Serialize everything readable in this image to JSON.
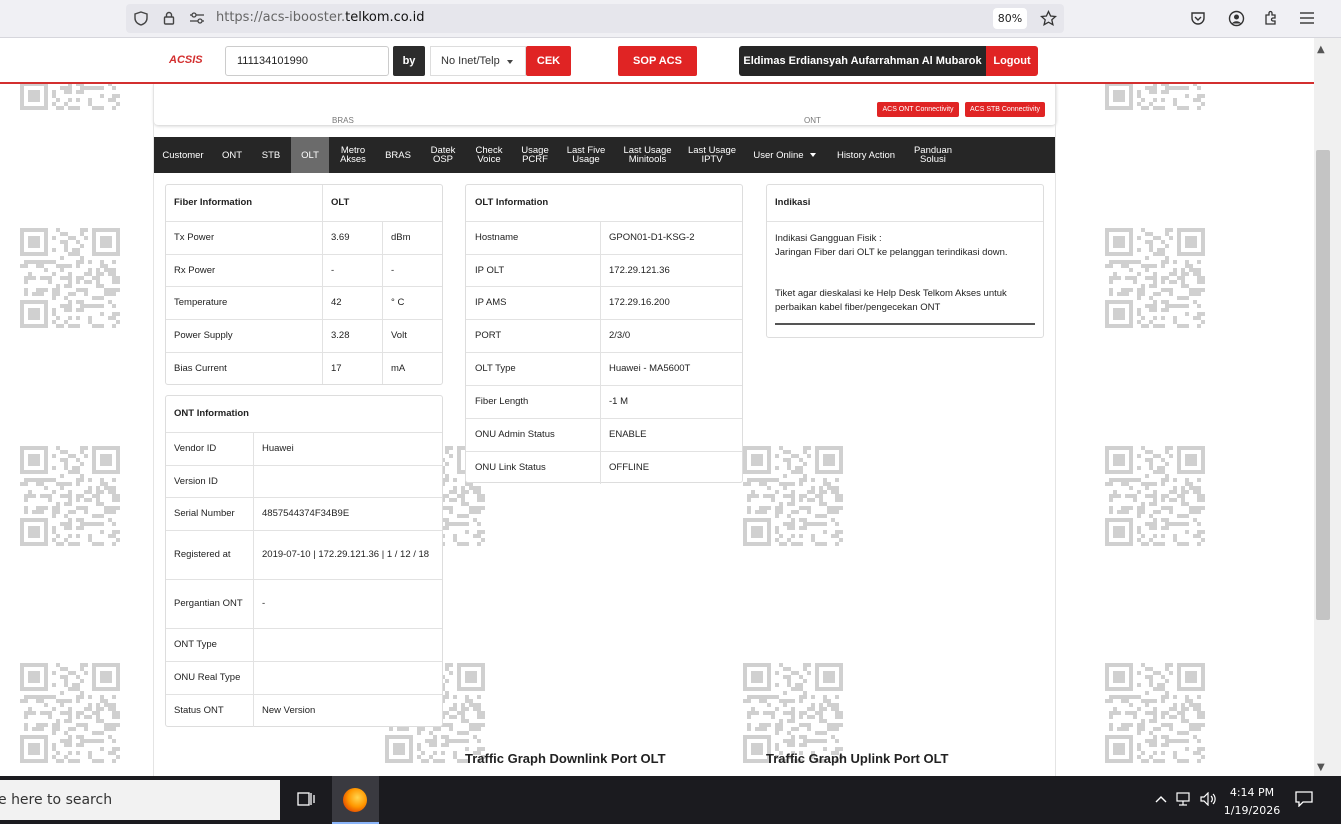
{
  "browser": {
    "url_prefix": "https://acs-ibooster.",
    "url_domain": "telkom.co.id",
    "zoom": "80%"
  },
  "header": {
    "logo": "ACSIS",
    "search_value": "111134101990",
    "by_label": "by",
    "search_type": "No Inet/Telp",
    "cek_label": "CEK",
    "sop_label": "SOP ACS",
    "user_name": "Eldimas Erdiansyah Aufarrahman Al Mubarok",
    "logout_label": "Logout"
  },
  "peek": {
    "bras_label": "BRAS",
    "ont_label": "ONT",
    "ont_conn_label": "ACS ONT Connectivity",
    "stb_conn_label": "ACS STB Connectivity"
  },
  "tabs": [
    {
      "l1": "Customer",
      "l2": ""
    },
    {
      "l1": "ONT",
      "l2": ""
    },
    {
      "l1": "STB",
      "l2": ""
    },
    {
      "l1": "OLT",
      "l2": ""
    },
    {
      "l1": "Metro",
      "l2": "Akses"
    },
    {
      "l1": "BRAS",
      "l2": ""
    },
    {
      "l1": "Datek",
      "l2": "OSP"
    },
    {
      "l1": "Check",
      "l2": "Voice"
    },
    {
      "l1": "Usage",
      "l2": "PCRF"
    },
    {
      "l1": "Last Five",
      "l2": "Usage"
    },
    {
      "l1": "Last Usage",
      "l2": "Minitools"
    },
    {
      "l1": "Last Usage",
      "l2": "IPTV"
    },
    {
      "l1": "User Online",
      "l2": ""
    },
    {
      "l1": "History Action",
      "l2": ""
    },
    {
      "l1": "Panduan",
      "l2": "Solusi"
    }
  ],
  "fiber": {
    "header": [
      "Fiber Information",
      "OLT"
    ],
    "rows": [
      [
        "Tx Power",
        "3.69",
        "dBm"
      ],
      [
        "Rx Power",
        "-",
        "-"
      ],
      [
        "Temperature",
        "42",
        "° C"
      ],
      [
        "Power Supply",
        "3.28",
        "Volt"
      ],
      [
        "Bias Current",
        "17",
        "mA"
      ]
    ]
  },
  "ont": {
    "header": "ONT Information",
    "rows": [
      [
        "Vendor ID",
        "Huawei"
      ],
      [
        "Version ID",
        ""
      ],
      [
        "Serial Number",
        "4857544374F34B9E"
      ],
      [
        "Registered at",
        "2019-07-10 | 172.29.121.36 | 1 / 12 / 18"
      ],
      [
        "Pergantian ONT",
        "-"
      ],
      [
        "ONT Type",
        ""
      ],
      [
        "ONU Real Type",
        ""
      ],
      [
        "Status ONT",
        "New Version"
      ]
    ]
  },
  "olt": {
    "header": "OLT Information",
    "rows": [
      [
        "Hostname",
        "GPON01-D1-KSG-2"
      ],
      [
        "IP OLT",
        "172.29.121.36"
      ],
      [
        "IP AMS",
        "172.29.16.200"
      ],
      [
        "PORT",
        "2/3/0"
      ],
      [
        "OLT Type",
        "Huawei - MA5600T"
      ],
      [
        "Fiber Length",
        "-1 M"
      ],
      [
        "ONU Admin Status",
        "ENABLE"
      ],
      [
        "ONU Link Status",
        "OFFLINE"
      ]
    ]
  },
  "indikasi": {
    "header": "Indikasi",
    "line1": "Indikasi Gangguan Fisik :",
    "line2": "Jaringan Fiber dari OLT ke pelanggan terindikasi down.",
    "line3": "Tiket agar dieskalasi ke Help Desk Telkom Akses untuk",
    "line4": "perbaikan kabel fiber/pengecekan ONT"
  },
  "graphs": {
    "downlink": "Traffic Graph Downlink Port OLT",
    "uplink": "Traffic Graph Uplink Port OLT"
  },
  "taskbar": {
    "search_text": "e here to search",
    "time": "4:14 PM",
    "date": "1/19/2026"
  }
}
